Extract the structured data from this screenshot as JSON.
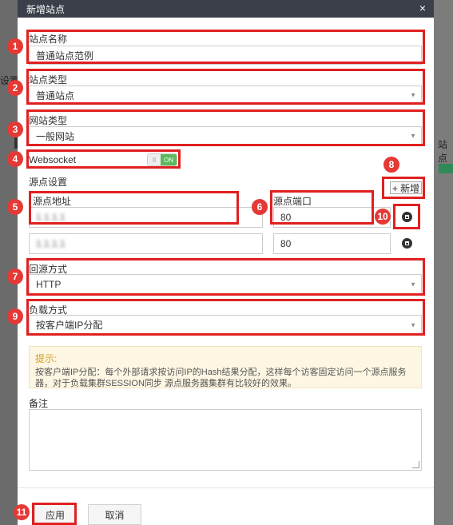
{
  "background": {
    "left_text": "设置",
    "right_text": "站点"
  },
  "dialog": {
    "title": "新增站点",
    "close_icon": "×"
  },
  "site_name": {
    "label": "站点名称",
    "value": "普通站点范例"
  },
  "site_type": {
    "label": "站点类型",
    "value": "普通站点"
  },
  "web_type": {
    "label": "网站类型",
    "value": "一般网站"
  },
  "websocket": {
    "label": "Websocket",
    "toggle_off": "II",
    "toggle_on": "ON",
    "state": "on"
  },
  "origin": {
    "section_label": "源点设置",
    "add_label": "+ 新增",
    "address_label": "源点地址",
    "port_label": "源点端口",
    "rows": [
      {
        "address": "1.1.1.1",
        "port": "80"
      },
      {
        "address": "1.1.1.1",
        "port": "80"
      }
    ]
  },
  "back_method": {
    "label": "回源方式",
    "value": "HTTP"
  },
  "load_method": {
    "label": "负载方式",
    "value": "按客户端IP分配"
  },
  "hint": {
    "title": "提示:",
    "text": "按客户端IP分配：每个外部请求按访问IP的Hash结果分配，这样每个访客固定访问一个源点服务器，对于负载集群SESSION同步 源点服务器集群有比较好的效果。"
  },
  "remark": {
    "label": "备注",
    "value": ""
  },
  "buttons": {
    "apply": "应用",
    "cancel": "取消"
  },
  "markers": [
    "1",
    "2",
    "3",
    "4",
    "5",
    "6",
    "7",
    "8",
    "9",
    "10",
    "11"
  ],
  "colors": {
    "titlebar": "#3a3f4a",
    "annotation": "#e02020",
    "toggle_on": "#5cb85c",
    "hint_title": "#d4a017"
  }
}
